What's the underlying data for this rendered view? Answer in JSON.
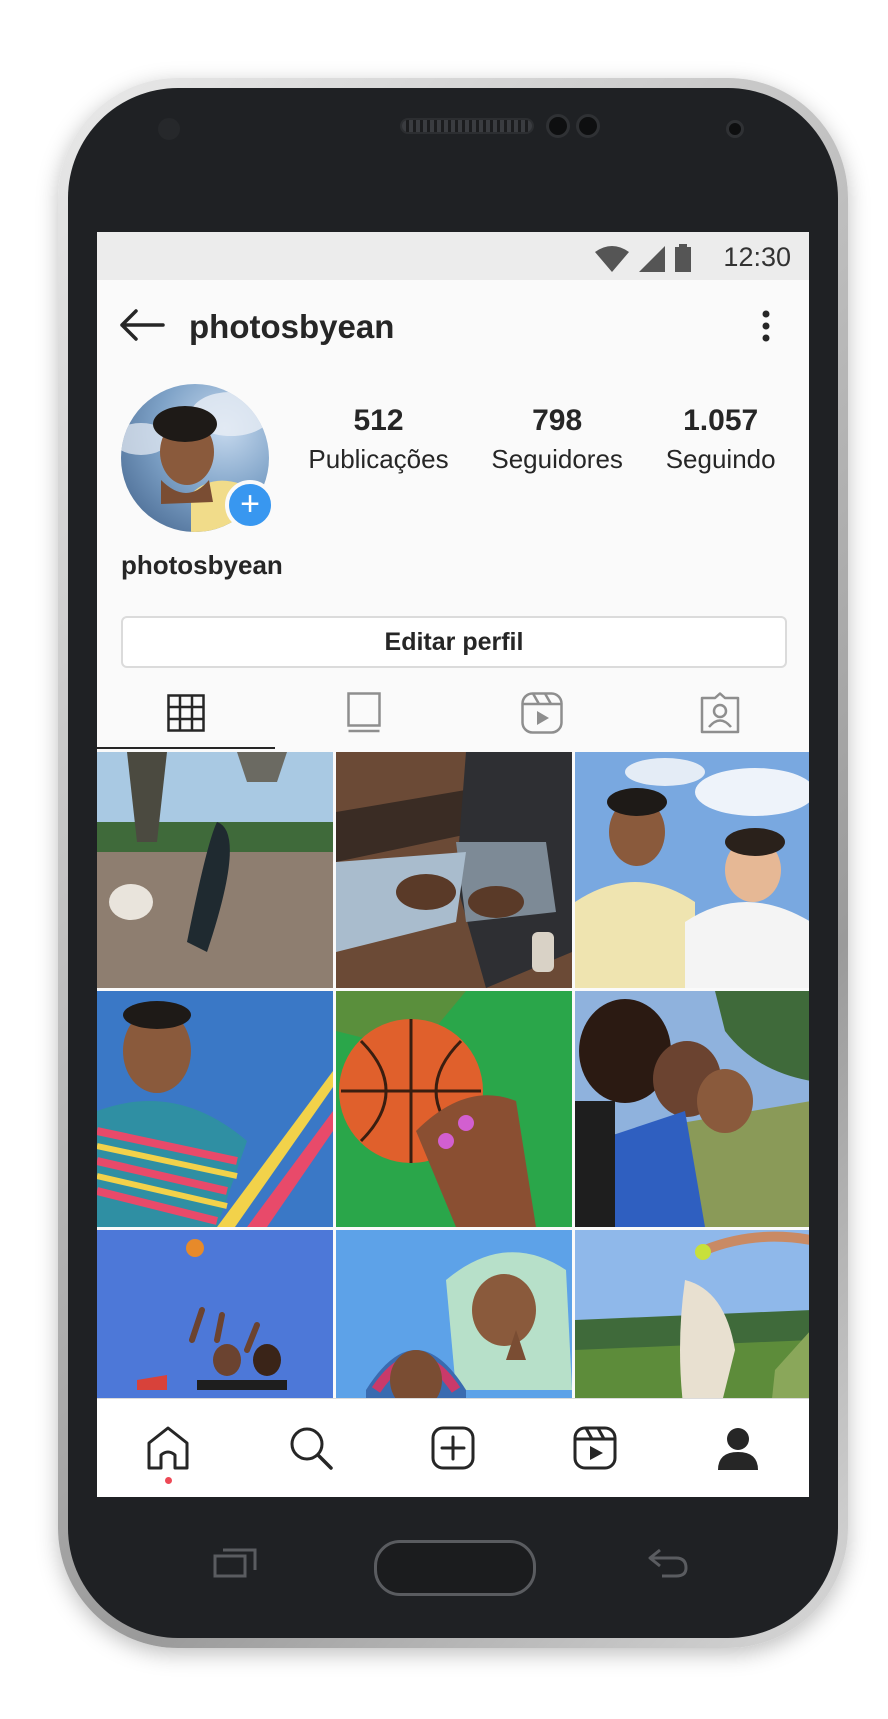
{
  "status": {
    "time": "12:30"
  },
  "header": {
    "username": "photosbyean"
  },
  "profile": {
    "display_name": "photosbyean",
    "stats": [
      {
        "value": "512",
        "label": "Publicações"
      },
      {
        "value": "798",
        "label": "Seguidores"
      },
      {
        "value": "1.057",
        "label": "Seguindo"
      }
    ],
    "edit_button": "Editar perfil"
  },
  "tabs": [
    {
      "icon": "grid-icon",
      "active": true
    },
    {
      "icon": "igtv-icon",
      "active": false
    },
    {
      "icon": "reels-icon",
      "active": false
    },
    {
      "icon": "tagged-icon",
      "active": false
    }
  ],
  "grid_photos": [
    {
      "subject": "skateboard",
      "colors": [
        "#9cc3e0",
        "#3b5b34",
        "#8c7a6b"
      ]
    },
    {
      "subject": "sitting-bench",
      "colors": [
        "#6b4a36",
        "#5a6a7a",
        "#2f2f34"
      ]
    },
    {
      "subject": "two-friends-selfie",
      "colors": [
        "#79a8e0",
        "#efe4b0",
        "#f4f4f4"
      ]
    },
    {
      "subject": "striped-shirt",
      "colors": [
        "#3a78c6",
        "#2f8fa3",
        "#e84a6a"
      ]
    },
    {
      "subject": "basketball",
      "colors": [
        "#e0602c",
        "#2aa64a",
        "#f1a27a"
      ]
    },
    {
      "subject": "group-selfie",
      "colors": [
        "#5b8c4a",
        "#2f5fc0",
        "#7a5a3a"
      ]
    },
    {
      "subject": "basketball-jump",
      "colors": [
        "#4d78d8",
        "#e78a2a",
        "#1e1e1e"
      ]
    },
    {
      "subject": "towel-selfie",
      "colors": [
        "#5da2e8",
        "#b7e0c9",
        "#c93a6a"
      ]
    },
    {
      "subject": "dog-jump",
      "colors": [
        "#8fb8ea",
        "#5d8c3a",
        "#e8e0d0"
      ]
    }
  ],
  "bottom_nav": [
    "home-icon",
    "search-icon",
    "new-post-icon",
    "reels-icon",
    "profile-icon"
  ],
  "colors": {
    "accent_blue": "#3897f0",
    "notification_red": "#ed4956",
    "text": "#262626"
  }
}
